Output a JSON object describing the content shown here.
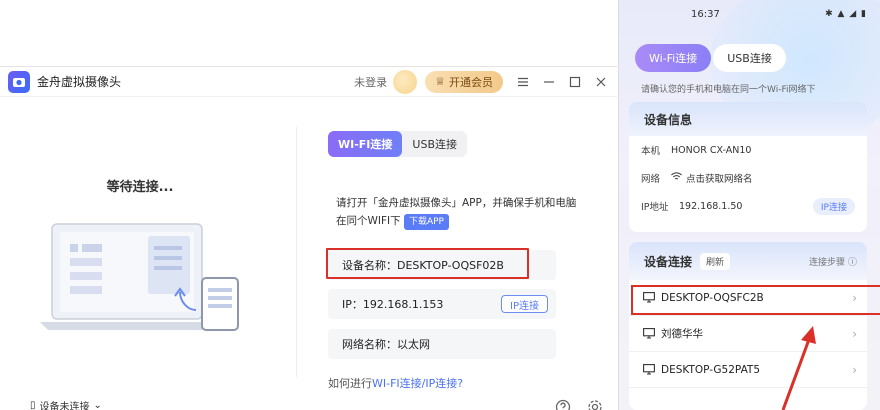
{
  "app": {
    "title": "金舟虚拟摄像头",
    "login_text": "未登录",
    "vip_label": "开通会员",
    "waiting_text": "等待连接...",
    "footer_device": "设备未连接",
    "tabs": [
      "WI-FI连接",
      "USB连接"
    ],
    "instruction": "请打开「金舟虚拟摄像头」APP，并确保手机和电脑在同个WIFI下",
    "download_label": "下载APP",
    "device_name_label": "设备名称：",
    "device_name_value": "DESKTOP-OQSF02B",
    "ip_label": "IP：",
    "ip_value": "192.168.1.153",
    "ip_connect_label": "IP连接",
    "net_label": "网络名称：",
    "net_value": "以太网",
    "help_prefix": "如何进行",
    "help_link": "WI-FI连接/IP连接?"
  },
  "phone": {
    "time": "16:37",
    "status_icons": "✱ ▲ ◢ ▮",
    "tabs": [
      "Wi-Fi连接",
      "USB连接"
    ],
    "tip": "请确认您的手机和电脑在同一个Wi-Fi网络下",
    "info_title": "设备信息",
    "info_rows": [
      {
        "key": "本机",
        "value": "HONOR CX-AN10"
      },
      {
        "key": "网络",
        "value": "点击获取网络名"
      },
      {
        "key": "IP地址",
        "value": "192.168.1.50"
      }
    ],
    "ip_connect_label": "IP连接",
    "conn_title": "设备连接",
    "refresh_label": "刷新",
    "steps_label": "连接步骤",
    "devices": [
      "DESKTOP-OQSFC2B",
      "刘德华华",
      "DESKTOP-G52PAT5"
    ]
  },
  "colors": {
    "accent": "#5b7cf7",
    "tab_gradient_start": "#8b6cf6",
    "highlight_red": "#d9302a",
    "vip_gold": "#f2c98a"
  }
}
